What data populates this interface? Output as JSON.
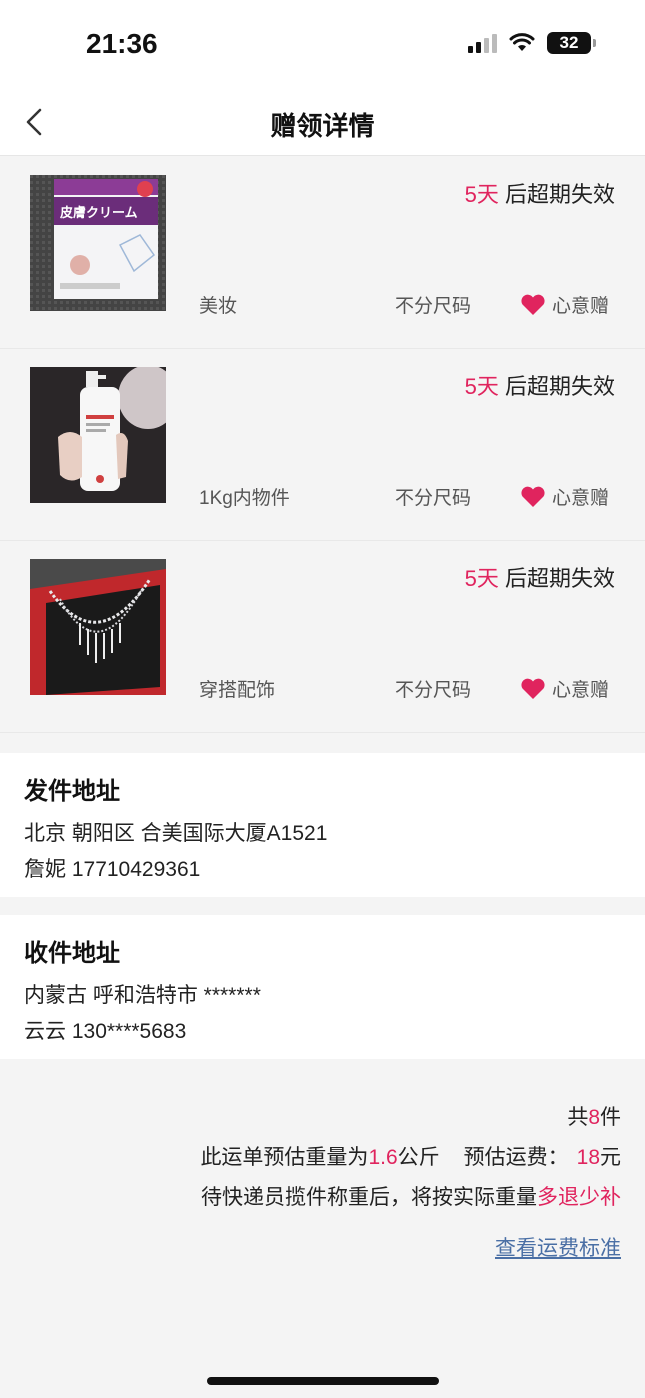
{
  "status_bar": {
    "time": "21:36",
    "battery": "32"
  },
  "nav": {
    "title": "赠领详情"
  },
  "items": [
    {
      "expiry_num": "5天",
      "expiry_suffix": " 后超期失效",
      "category": "美妆",
      "size": "不分尺码",
      "gift_label": "心意赠",
      "image": "skin-cream-box"
    },
    {
      "expiry_num": "5天",
      "expiry_suffix": " 后超期失效",
      "category": "1Kg内物件",
      "size": "不分尺码",
      "gift_label": "心意赠",
      "image": "lotion-bottle"
    },
    {
      "expiry_num": "5天",
      "expiry_suffix": " 后超期失效",
      "category": "穿搭配饰",
      "size": "不分尺码",
      "gift_label": "心意赠",
      "image": "necklace"
    }
  ],
  "sender": {
    "title": "发件地址",
    "address": "北京 朝阳区 合美国际大厦A1521",
    "contact": "詹妮 17710429361"
  },
  "receiver": {
    "title": "收件地址",
    "address": "内蒙古 呼和浩特市 *******",
    "contact": "云云 130****5683"
  },
  "summary": {
    "count_prefix": "共",
    "count": "8",
    "count_suffix": "件",
    "weight_prefix": "此运单预估重量为",
    "weight": "1.6",
    "weight_unit": "公斤",
    "fee_label": "预估运费：",
    "fee": "18",
    "fee_unit": "元",
    "note_prefix": "待快递员揽件称重后，将按实际重量",
    "note_highlight": "多退少补",
    "link": "查看运费标准"
  },
  "colors": {
    "accent": "#e0245e",
    "link": "#4a6fa5",
    "background": "#f4f4f4"
  }
}
